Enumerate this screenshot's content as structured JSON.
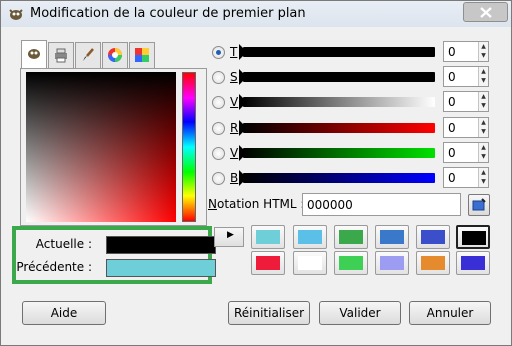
{
  "window": {
    "title": "Modification de la couleur de premier plan"
  },
  "tabs": [
    {
      "icon": "gimp-icon"
    },
    {
      "icon": "printer-icon"
    },
    {
      "icon": "brush-icon"
    },
    {
      "icon": "color-wheel-icon"
    },
    {
      "icon": "palette-icon"
    }
  ],
  "compare": {
    "current_label": "Actuelle :",
    "current_color": "#000000",
    "previous_label": "Précédente :",
    "previous_color": "#6fcfd8"
  },
  "sliders": [
    {
      "label": "T",
      "value": "0",
      "checked": true,
      "gradient": "linear-gradient(to right,#000,#000)"
    },
    {
      "label": "S",
      "value": "0",
      "checked": false,
      "gradient": "linear-gradient(to right,#000,#000)"
    },
    {
      "label": "V",
      "value": "0",
      "checked": false,
      "gradient": "linear-gradient(to right,#000,#fff)"
    },
    {
      "label": "R",
      "value": "0",
      "checked": false,
      "gradient": "linear-gradient(to right,#000,#ff0000)"
    },
    {
      "label": "V",
      "value": "0",
      "checked": false,
      "gradient": "linear-gradient(to right,#000,#00e000)"
    },
    {
      "label": "B",
      "value": "0",
      "checked": false,
      "gradient": "linear-gradient(to right,#000,#0000ff)"
    }
  ],
  "html_notation": {
    "label": "Notation HTML :",
    "value": "000000"
  },
  "history": [
    "#6fcfd8",
    "#5bc0e8",
    "#3aa84b",
    "#3a78c9",
    "#3a4fc9",
    "#000000",
    "#ee1c3a",
    "#ffffff",
    "#3ecf55",
    "#9c9cf2",
    "#e68a2e",
    "#3a2ed6"
  ],
  "buttons": {
    "help": "Aide",
    "reset": "Réinitialiser",
    "ok": "Valider",
    "cancel": "Annuler"
  },
  "colors": {
    "highlight_box": "#3aa84b"
  }
}
